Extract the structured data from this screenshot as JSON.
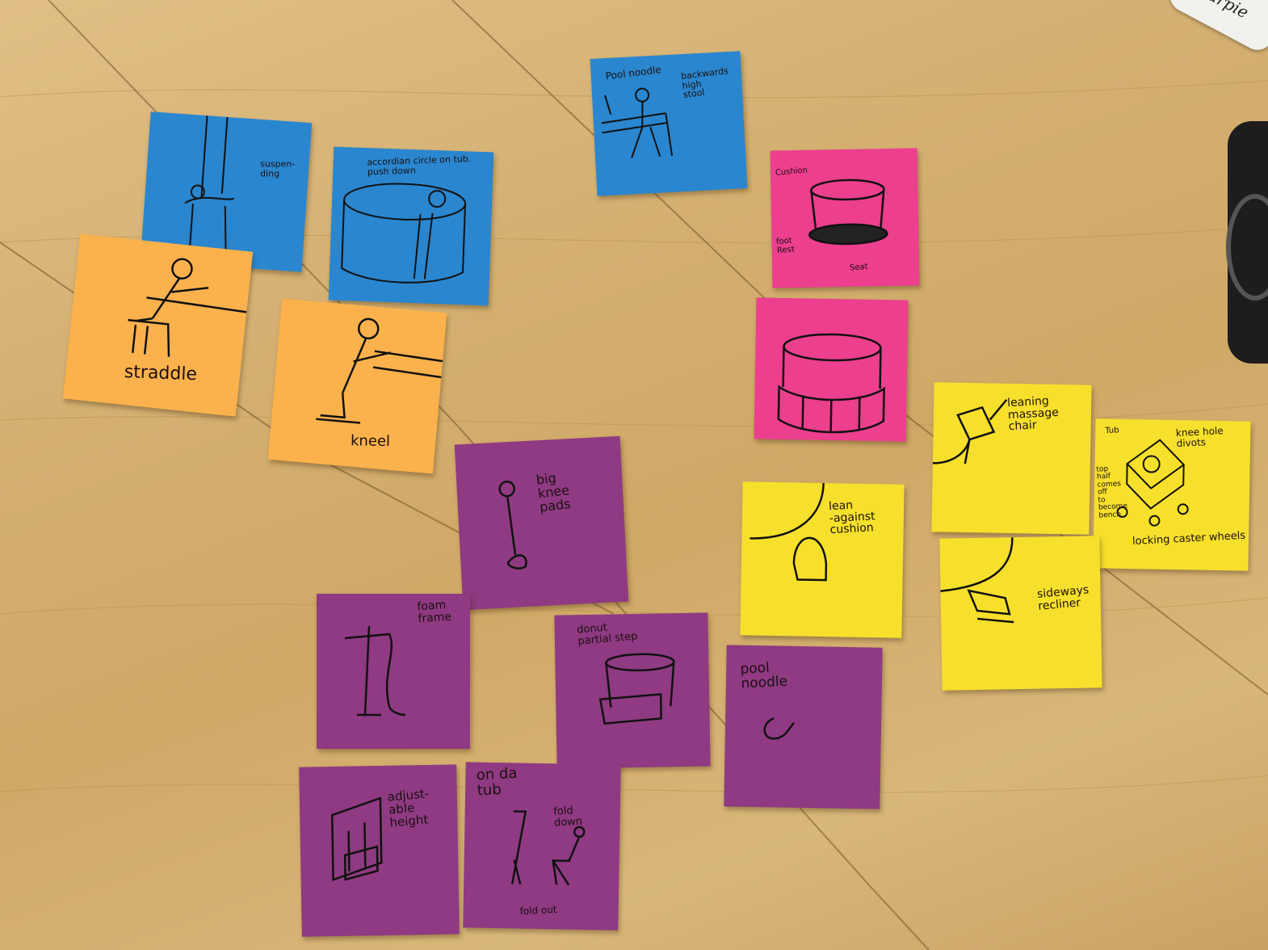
{
  "marker": {
    "brand": "Sharpie"
  },
  "notes": {
    "suspending": "suspen-\nding",
    "accordion": "accordian circle on tub.\npush down",
    "pool_noodle_top": "Pool noodle",
    "high_stool": "backwards\nhigh\nstool",
    "straddle": "straddle",
    "kneel": "kneel",
    "cushion": "Cushion",
    "foot_rest": "foot\nRest",
    "seat": "Seat",
    "big_knee_pads": "big\nknee\npads",
    "leaning_massage_chair": "leaning\nmassage\nchair",
    "tub": "Tub",
    "knee_hole_divots": "knee hole\ndivots",
    "top_half": "top\nhalf\ncomes\noff\nto\nbecome\nbench",
    "locking_caster_wheels": "locking caster wheels",
    "lean_against_cushion": "lean\n-against\ncushion",
    "sideways_recliner": "sideways\nrecliner",
    "foam_frame": "foam\nframe",
    "donut_partial_step": "donut\npartial step",
    "pool_noodle_purple": "pool\nnoodle",
    "adjustable_height": "adjust-\nable\nheight",
    "on_da_tub": "on da\ntub",
    "fold_down": "fold\ndown",
    "fold_out": "fold out"
  }
}
